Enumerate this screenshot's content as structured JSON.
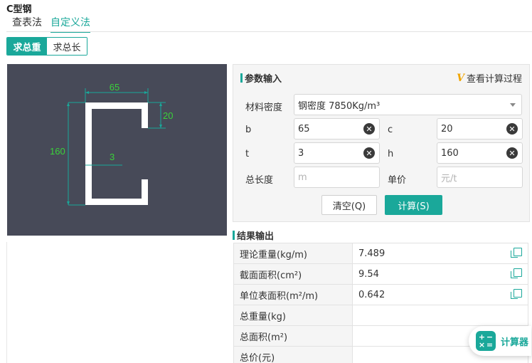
{
  "page": {
    "title": "C型钢"
  },
  "method_tabs": [
    {
      "label": "查表法",
      "active": false
    },
    {
      "label": "自定义法",
      "active": true
    }
  ],
  "mode_toggle": {
    "weight": "求总重",
    "length": "求总长"
  },
  "diagram": {
    "dim_b": "65",
    "dim_c": "20",
    "dim_h": "160",
    "dim_t": "3",
    "label_color": "#3ad13a",
    "bg_color": "#474a58"
  },
  "params": {
    "heading": "参数输入",
    "view_process": "查看计算过程",
    "density_label": "材料密度",
    "density_value": "钢密度 7850Kg/m³",
    "b_label": "b",
    "b_value": "65",
    "c_label": "c",
    "c_value": "20",
    "t_label": "t",
    "t_value": "3",
    "h_label": "h",
    "h_value": "160",
    "total_length_label": "总长度",
    "total_length_placeholder": "m",
    "unit_price_label": "单价",
    "unit_price_placeholder": "元/t",
    "clear_button": "清空(Q)",
    "calc_button": "计算(S)"
  },
  "results": {
    "heading": "结果输出",
    "rows": [
      {
        "label": "理论重量(kg/m)",
        "value": "7.489"
      },
      {
        "label": "截面面积(cm²)",
        "value": "9.54"
      },
      {
        "label": "单位表面积(m²/m)",
        "value": "0.642"
      },
      {
        "label": "总重量(kg)",
        "value": ""
      },
      {
        "label": "总面积(m²)",
        "value": ""
      },
      {
        "label": "总价(元)",
        "value": ""
      }
    ]
  },
  "floating": {
    "label": "计算器"
  },
  "colors": {
    "accent": "#1aa89a",
    "icon_accent": "#f0a500"
  }
}
